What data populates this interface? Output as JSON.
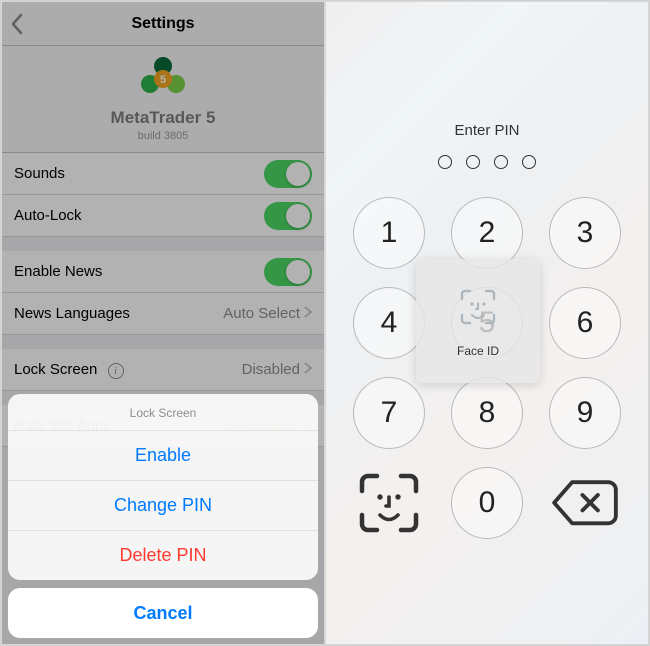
{
  "nav": {
    "title": "Settings"
  },
  "brand": {
    "name": "MetaTrader 5",
    "build": "build 3805"
  },
  "rows": {
    "sounds": "Sounds",
    "autolock": "Auto-Lock",
    "enablenews": "Enable News",
    "newslang_label": "News Languages",
    "newslang_value": "Auto Select",
    "lockscreen_label": "Lock Screen",
    "lockscreen_value": "Disabled",
    "rate_label": "Rate this App!"
  },
  "sheet": {
    "title": "Lock Screen",
    "enable": "Enable",
    "change": "Change PIN",
    "delete": "Delete PIN",
    "cancel": "Cancel"
  },
  "pin": {
    "title": "Enter PIN",
    "faceid": "Face ID",
    "keys": [
      "1",
      "2",
      "3",
      "4",
      "5",
      "6",
      "7",
      "8",
      "9",
      "0"
    ]
  }
}
